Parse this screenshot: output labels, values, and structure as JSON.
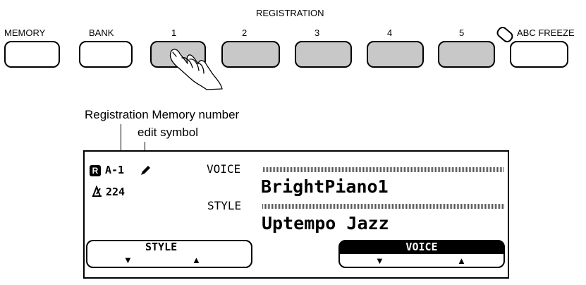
{
  "panel": {
    "registration_label": "REGISTRATION",
    "buttons": [
      {
        "label": "MEMORY"
      },
      {
        "label": "BANK"
      },
      {
        "label": "1"
      },
      {
        "label": "2"
      },
      {
        "label": "3"
      },
      {
        "label": "4"
      },
      {
        "label": "5"
      },
      {
        "label": "ABC FREEZE"
      }
    ]
  },
  "annotations": {
    "reg_memory_number": "Registration Memory number",
    "edit_symbol": "edit symbol"
  },
  "lcd": {
    "reg_icon": "R",
    "reg_number": "A-1",
    "tempo_value": "224",
    "voice_label": "VOICE",
    "voice_name": "BrightPiano1",
    "style_label": "STYLE",
    "style_name": "Uptempo Jazz",
    "softkey_left": {
      "label": "STYLE",
      "down": "▼",
      "up": "▲"
    },
    "softkey_right": {
      "label": "VOICE",
      "down": "▼",
      "up": "▲"
    }
  }
}
